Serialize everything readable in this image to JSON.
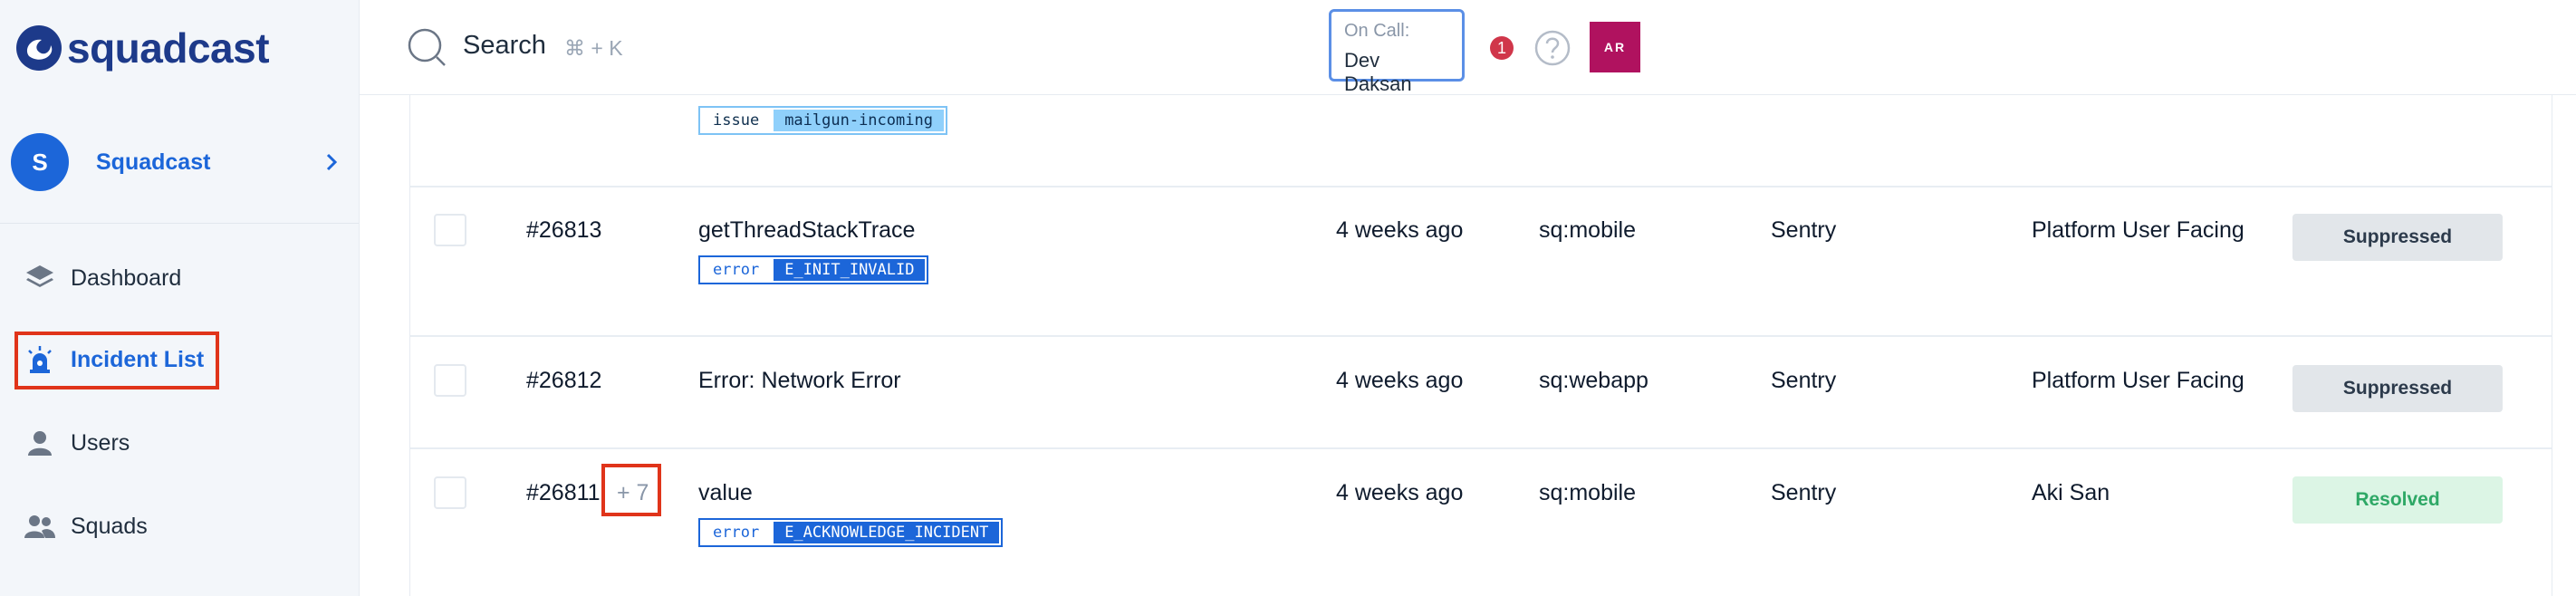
{
  "brand": {
    "name": "squadcast"
  },
  "org": {
    "initial": "S",
    "name": "Squadcast"
  },
  "nav": [
    {
      "id": "dashboard",
      "label": "Dashboard"
    },
    {
      "id": "incident-list",
      "label": "Incident List"
    },
    {
      "id": "users",
      "label": "Users"
    },
    {
      "id": "squads",
      "label": "Squads"
    }
  ],
  "header": {
    "search_label": "Search",
    "search_hint": "⌘ + K",
    "oncall_label": "On Call:",
    "oncall_name": "Dev Daksan",
    "notification_count": "1",
    "user_initials": "AR"
  },
  "top_tag": {
    "key": "issue",
    "value": "mailgun-incoming"
  },
  "incidents": [
    {
      "id": "#26813",
      "title": "getThreadStackTrace",
      "tag_key": "error",
      "tag_value": "E_INIT_INVALID",
      "created": "4 weeks ago",
      "service": "sq:mobile",
      "source": "Sentry",
      "assignee": "Platform User Facing",
      "status": "Suppressed"
    },
    {
      "id": "#26812",
      "title": "Error: Network Error",
      "created": "4 weeks ago",
      "service": "sq:webapp",
      "source": "Sentry",
      "assignee": "Platform User Facing",
      "status": "Suppressed"
    },
    {
      "id": "#26811",
      "extra": "+ 7",
      "title": "value",
      "tag_key": "error",
      "tag_value": "E_ACKNOWLEDGE_INCIDENT",
      "created": "4 weeks ago",
      "service": "sq:mobile",
      "source": "Sentry",
      "assignee": "Aki San",
      "status": "Resolved"
    }
  ],
  "colors": {
    "accent": "#1c66d9",
    "highlight_box": "#e0341a",
    "resolved": "#2ea866"
  }
}
